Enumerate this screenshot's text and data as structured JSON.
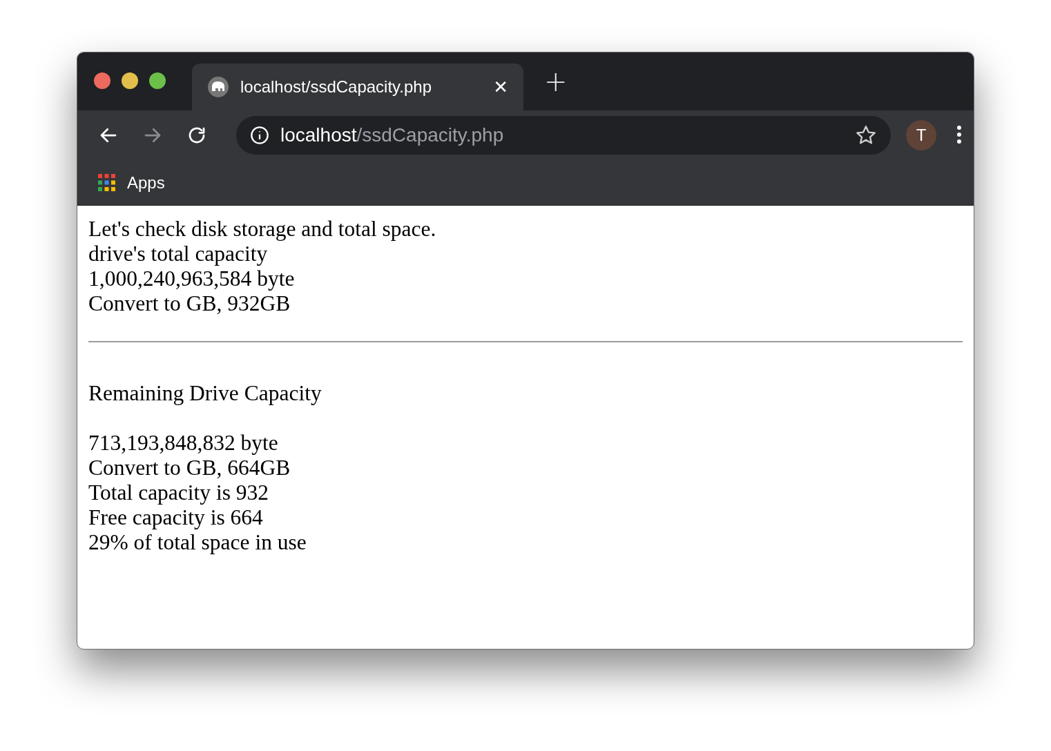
{
  "tab": {
    "title": "localhost/ssdCapacity.php",
    "close": "✕",
    "new_tab": "+"
  },
  "address_bar": {
    "host": "localhost",
    "path": "/ssdCapacity.php"
  },
  "profile": {
    "initial": "T"
  },
  "bookmarks": [
    {
      "label": "Apps"
    }
  ],
  "page": {
    "blocks": [
      {
        "kind": "lines",
        "lines": [
          "Let's check disk storage and total space.",
          "drive's total capacity",
          "1,000,240,963,584 byte",
          "Convert to GB, 932GB"
        ]
      },
      {
        "kind": "rule"
      },
      {
        "kind": "lines",
        "lines": [
          "Remaining Drive Capacity"
        ]
      },
      {
        "kind": "lines",
        "lines": [
          "713,193,848,832 byte",
          "Convert to GB, 664GB",
          "Total capacity is 932",
          "Free capacity is 664",
          "29% of total space in use"
        ]
      }
    ]
  }
}
